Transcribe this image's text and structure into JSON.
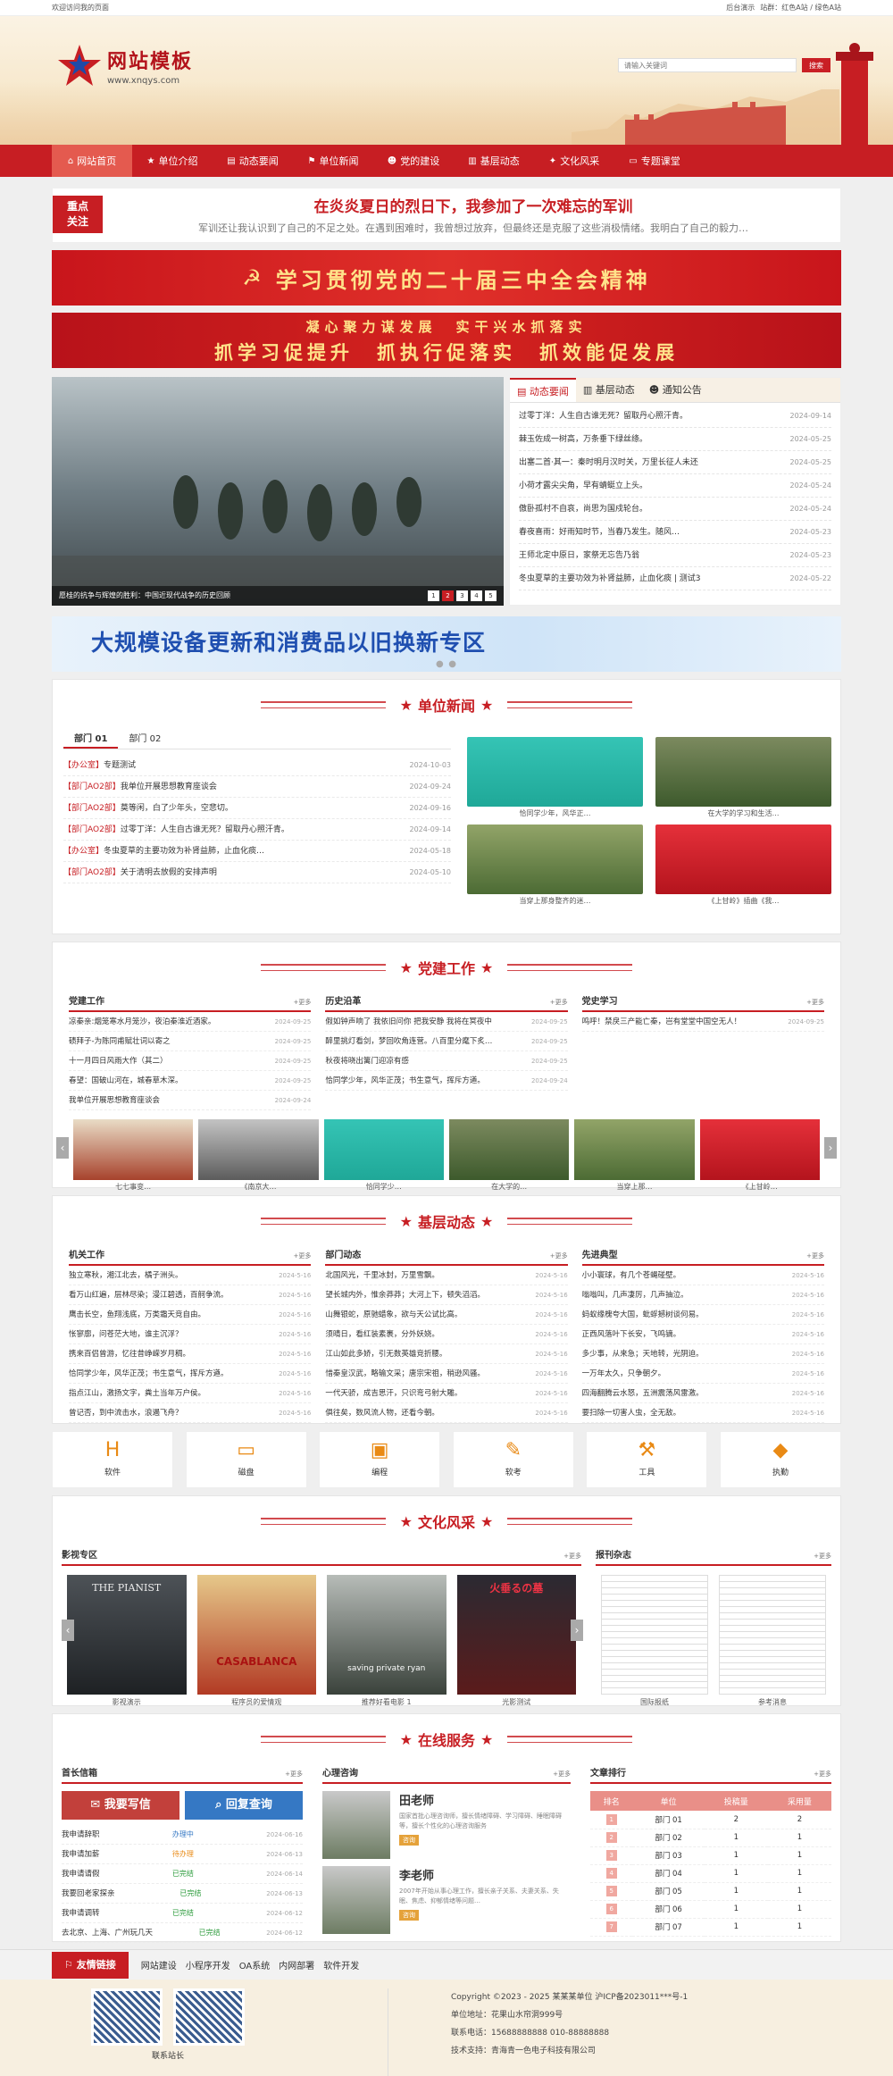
{
  "topbar": {
    "welcome": "欢迎访问我的页面",
    "links": [
      "后台演示",
      "站群：红色A站 / 绿色A站"
    ]
  },
  "site": {
    "name": "网站模板",
    "domain": "www.xnqys.com",
    "search_placeholder": "请输入关键词",
    "search_btn": "搜索"
  },
  "nav": [
    "网站首页",
    "单位介绍",
    "动态要闻",
    "单位新闻",
    "党的建设",
    "基层动态",
    "文化风采",
    "专题课堂"
  ],
  "focus": {
    "tag1": "重点",
    "tag2": "关注",
    "title": "在炎炎夏日的烈日下，我参加了一次难忘的军训",
    "desc": "军训还让我认识到了自己的不足之处。在遇到困难时，我曾想过放弃，但最终还是克服了这些消极情绪。我明白了自己的毅力…"
  },
  "banner1": "学习贯彻党的二十届三中全会精神",
  "banner2": {
    "a": "凝心聚力谋发展　实干兴水抓落实",
    "b": "抓学习促提升　抓执行促落实　抓效能促发展"
  },
  "hero": {
    "caption": "愿桂的抗争与辉煌的胜利：中国近现代战争的历史回顾",
    "dots": [
      "1",
      "2",
      "3",
      "4",
      "5"
    ],
    "tabs": [
      "动态要闻",
      "基层动态",
      "通知公告"
    ],
    "news": [
      [
        "过零丁洋：人生自古谁无死？留取丹心照汗青。",
        "2024-09-14"
      ],
      [
        "棘玉佐成一树高，万条垂下绿丝绦。",
        "2024-05-25"
      ],
      [
        "出塞二首·其一：秦时明月汉时关，万里长征人未还",
        "2024-05-25"
      ],
      [
        "小荷才露尖尖角，早有蜻蜓立上头。",
        "2024-05-24"
      ],
      [
        "傲卧孤村不自哀，尚思为国戍轮台。",
        "2024-05-24"
      ],
      [
        "春夜喜雨：好雨知时节，当春乃发生。随风…",
        "2024-05-23"
      ],
      [
        "王师北定中原日，家祭无忘告乃翁",
        "2024-05-23"
      ],
      [
        "冬虫夏草的主要功效为补肾益肺，止血化痰 | 测试3",
        "2024-05-22"
      ]
    ]
  },
  "banner3": "大规模设备更新和消费品以旧换新专区",
  "unit": {
    "title": "单位新闻",
    "tabs": [
      "部门 01",
      "部门 02"
    ],
    "list": [
      [
        "【办公室】",
        "专题测试",
        "2024-10-03"
      ],
      [
        "【部门AO2部】",
        "我单位开展思想教育座谈会",
        "2024-09-24"
      ],
      [
        "【部门AO2部】",
        "莫等闲，白了少年头，空悲切。",
        "2024-09-16"
      ],
      [
        "【部门AO2部】",
        "过零丁洋：人生自古谁无死？留取丹心照汗青。",
        "2024-09-14"
      ],
      [
        "【办公室】",
        "冬虫夏草的主要功效为补肾益肺，止血化痰…",
        "2024-05-18"
      ],
      [
        "【部门AO2部】",
        "关于清明去放假的安排声明",
        "2024-05-10"
      ]
    ],
    "pics": [
      "恰同学少年，风华正…",
      "在大学的学习和生活…",
      "当穿上那身整齐的迷…",
      "《上甘岭》插曲《我…"
    ]
  },
  "party": {
    "title": "党建工作",
    "more": "更多",
    "cols": [
      {
        "h": "党建工作",
        "items": [
          [
            "凉秦亲:烟笼寒水月笼沙，夜泊秦淮近酒家。",
            "2024-09-25"
          ],
          [
            "碛拜子-为陈同甫赋壮词以寄之",
            "2024-09-25"
          ],
          [
            "十一月四日风雨大作（其二）",
            "2024-09-25"
          ],
          [
            "春望：国破山河在，城春草木深。",
            "2024-09-25"
          ],
          [
            "我单位开展思想教育座谈会",
            "2024-09-24"
          ]
        ]
      },
      {
        "h": "历史沿革",
        "items": [
          [
            "假如钟声响了 我依旧问你 把我安静 我将在冥夜中",
            "2024-09-25"
          ],
          [
            "醉里挑灯看剑，梦回吹角连营。八百里分麾下炙…",
            "2024-09-25"
          ],
          [
            "秋夜将晓出篱门迎凉有感",
            "2024-09-25"
          ],
          [
            "恰同学少年，风华正茂；书生意气，挥斥方遒。",
            "2024-09-24"
          ]
        ]
      },
      {
        "h": "党史学习",
        "items": [
          [
            "鸣呼！禁戾三产能亡秦，岂有堂堂中国空无人！",
            "2024-09-25"
          ]
        ]
      }
    ],
    "thumbs": [
      "七七事变…",
      "《南京大…",
      "恰同学少…",
      "在大学的…",
      "当穿上那…",
      "《上甘岭…"
    ]
  },
  "grass": {
    "title": "基层动态",
    "more": "更多",
    "cols": [
      {
        "h": "机关工作",
        "items": [
          [
            "独立寒秋，湘江北去，橘子洲头。",
            "2024-5-16"
          ],
          [
            "看万山红遍，层林尽染；漫江碧透，百舸争流。",
            "2024-5-16"
          ],
          [
            "鹰击长空，鱼翔浅底，万类霜天竞自由。",
            "2024-5-16"
          ],
          [
            "怅寥廓，问苍茫大地，谁主沉浮？",
            "2024-5-16"
          ],
          [
            "携来百侣曾游，忆往昔峥嵘岁月稠。",
            "2024-5-16"
          ],
          [
            "恰同学少年，风华正茂；书生意气，挥斥方遒。",
            "2024-5-16"
          ],
          [
            "指点江山，激扬文字，粪土当年万户侯。",
            "2024-5-16"
          ],
          [
            "曾记否，到中流击水，浪遏飞舟？",
            "2024-5-16"
          ]
        ]
      },
      {
        "h": "部门动态",
        "items": [
          [
            "北国风光，千里冰封，万里雪飘。",
            "2024-5-16"
          ],
          [
            "望长城内外，惟余莽莽；大河上下，顿失滔滔。",
            "2024-5-16"
          ],
          [
            "山舞银蛇，原驰蜡象，欲与天公试比高。",
            "2024-5-16"
          ],
          [
            "须晴日，看红装素裹，分外妖娆。",
            "2024-5-16"
          ],
          [
            "江山如此多娇，引无数英雄竞折腰。",
            "2024-5-16"
          ],
          [
            "惜秦皇汉武，略输文采；唐宗宋祖，稍逊风骚。",
            "2024-5-16"
          ],
          [
            "一代天骄，成吉思汗，只识弯弓射大雕。",
            "2024-5-16"
          ],
          [
            "俱往矣，数风流人物，还看今朝。",
            "2024-5-16"
          ]
        ]
      },
      {
        "h": "先进典型",
        "items": [
          [
            "小小寰球，有几个苍蝇碰壁。",
            "2024-5-16"
          ],
          [
            "嗡嗡叫，几声凄厉，几声抽泣。",
            "2024-5-16"
          ],
          [
            "蚂蚁缘槐夸大国，蚍蜉撼树谈何易。",
            "2024-5-16"
          ],
          [
            "正西风落叶下长安，飞鸣镝。",
            "2024-5-16"
          ],
          [
            "多少事，从来急；天地转，光阴迫。",
            "2024-5-16"
          ],
          [
            "一万年太久，只争朝夕。",
            "2024-5-16"
          ],
          [
            "四海翻腾云水怒，五洲震荡风雷激。",
            "2024-5-16"
          ],
          [
            "要扫除一切害人虫，全无敌。",
            "2024-5-16"
          ]
        ]
      }
    ]
  },
  "icons": [
    {
      "g": "H",
      "l": "软件"
    },
    {
      "g": "▭",
      "l": "磁盘"
    },
    {
      "g": "▣",
      "l": "编程"
    },
    {
      "g": "✎",
      "l": "软考"
    },
    {
      "g": "⚒",
      "l": "工具"
    },
    {
      "g": "◆",
      "l": "执勤"
    }
  ],
  "culture": {
    "title": "文化风采",
    "more": "更多",
    "film_h": "影视专区",
    "mag_h": "报刊杂志",
    "films": [
      "影视演示",
      "程序员的爱情观",
      "推荐好看电影 1",
      "光影测试"
    ],
    "posters": [
      "THE PIANIST",
      "CASABLANCA",
      "saving private ryan",
      "火垂るの墓"
    ],
    "mags": [
      "国际报纸",
      "参考消息"
    ]
  },
  "service": {
    "title": "在线服务",
    "more": "更多",
    "h1": "首长信箱",
    "h2": "心理咨询",
    "h3": "文章排行",
    "btn1": "我要写信",
    "btn2": "回复查询",
    "letters": [
      [
        "我申请辞职",
        "办理中",
        "2024-06-16"
      ],
      [
        "我申请加薪",
        "待办理",
        "2024-06-13"
      ],
      [
        "我申请请假",
        "已完结",
        "2024-06-14"
      ],
      [
        "我要回老家探亲",
        "已完结",
        "2024-06-13"
      ],
      [
        "我申请调转",
        "已完结",
        "2024-06-12"
      ],
      [
        "去北京、上海、广州玩几天",
        "已完结",
        "2024-06-12"
      ]
    ],
    "teachers": [
      {
        "n": "田老师",
        "d": "国家首批心理咨询师，擅长情绪障碍、学习障碍、睡眠障碍等，擅长个性化的心理咨询服务",
        "m": "咨询"
      },
      {
        "n": "李老师",
        "d": "2007年开始从事心理工作，擅长亲子关系、夫妻关系、失眠、焦虑、抑郁情绪等问题…",
        "m": "咨询"
      }
    ],
    "rank_head": [
      "排名",
      "单位",
      "投稿量",
      "采用量"
    ],
    "rank": [
      [
        "1",
        "部门 01",
        "2",
        "2"
      ],
      [
        "2",
        "部门 02",
        "1",
        "1"
      ],
      [
        "3",
        "部门 03",
        "1",
        "1"
      ],
      [
        "4",
        "部门 04",
        "1",
        "1"
      ],
      [
        "5",
        "部门 05",
        "1",
        "1"
      ],
      [
        "6",
        "部门 06",
        "1",
        "1"
      ],
      [
        "7",
        "部门 07",
        "1",
        "1"
      ]
    ]
  },
  "links": {
    "label": "友情链接",
    "items": [
      "网站建设",
      "小程序开发",
      "OA系统",
      "内网部署",
      "软件开发"
    ]
  },
  "footer": {
    "qr_label": "联系站长",
    "lines": [
      "Copyright ©2023 - 2025 某某某单位 沪ICP备2023011***号-1",
      "单位地址：花果山水帘洞999号",
      "联系电话：15688888888 010-88888888",
      "技术支持：青海青一色电子科技有限公司"
    ]
  },
  "colors": {
    "brand": "#c71e23",
    "orange": "#e98a15"
  }
}
